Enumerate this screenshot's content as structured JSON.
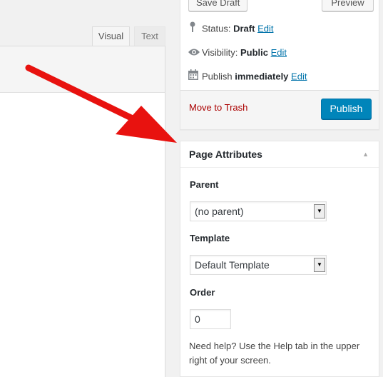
{
  "editor": {
    "tabs": [
      {
        "label": "Visual"
      },
      {
        "label": "Text"
      }
    ]
  },
  "publish": {
    "save_draft_label": "Save Draft",
    "preview_label": "Preview",
    "status": {
      "label": "Status:",
      "value": "Draft",
      "edit": "Edit",
      "icon": "pin-icon"
    },
    "visibility": {
      "label": "Visibility:",
      "value": "Public",
      "edit": "Edit",
      "icon": "eye-icon"
    },
    "schedule": {
      "label": "Publish",
      "value": "immediately",
      "edit": "Edit",
      "icon": "calendar-icon"
    },
    "trash_label": "Move to Trash",
    "publish_label": "Publish"
  },
  "page_attributes": {
    "title": "Page Attributes",
    "parent_label": "Parent",
    "parent_value": "(no parent)",
    "template_label": "Template",
    "template_value": "Default Template",
    "order_label": "Order",
    "order_value": "0",
    "help_text": "Need help? Use the Help tab in the upper right of your screen."
  },
  "colors": {
    "accent": "#0085ba",
    "link": "#0073aa",
    "trash": "#aa0000",
    "annotation_arrow": "#e8120f"
  }
}
